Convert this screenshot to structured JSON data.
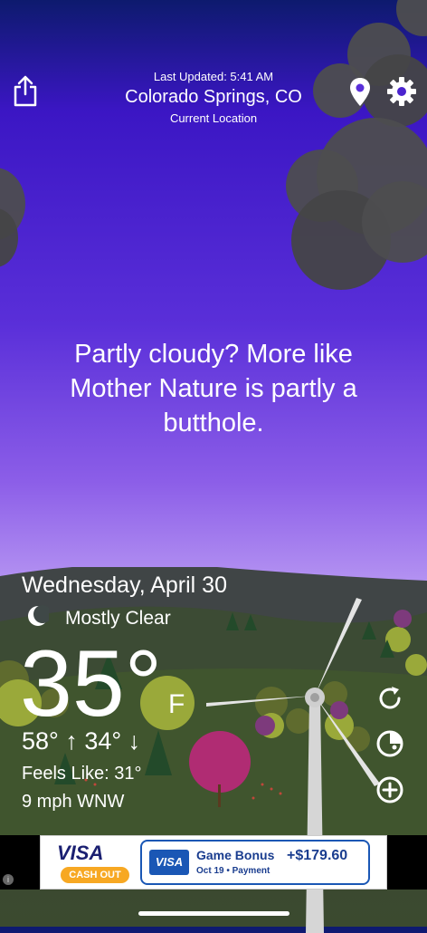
{
  "header": {
    "last_updated": "Last Updated: 5:41 AM",
    "city": "Colorado Springs, CO",
    "location_label": "Current Location"
  },
  "quote": "Partly cloudy? More like Mother Nature is partly a butthole.",
  "weather": {
    "date": "Wednesday, April 30",
    "condition": "Mostly Clear",
    "temperature": "35°",
    "unit": "F",
    "high_low": "58° ↑  34° ↓",
    "feels_like": "Feels Like: 31°",
    "wind": "9 mph WNW"
  },
  "icons": {
    "share": "share-icon",
    "location": "location-pin-icon",
    "settings": "gear-icon",
    "condition": "crescent-moon-icon",
    "refresh": "refresh-icon",
    "radar": "radar-icon",
    "add": "plus-circle-icon"
  },
  "ad": {
    "brand": "VISA",
    "cashout": "CASH OUT",
    "card_brand": "VISA",
    "title": "Game Bonus",
    "amount": "+$179.60",
    "subtitle": "Oct 19 • Payment",
    "info": "i"
  }
}
